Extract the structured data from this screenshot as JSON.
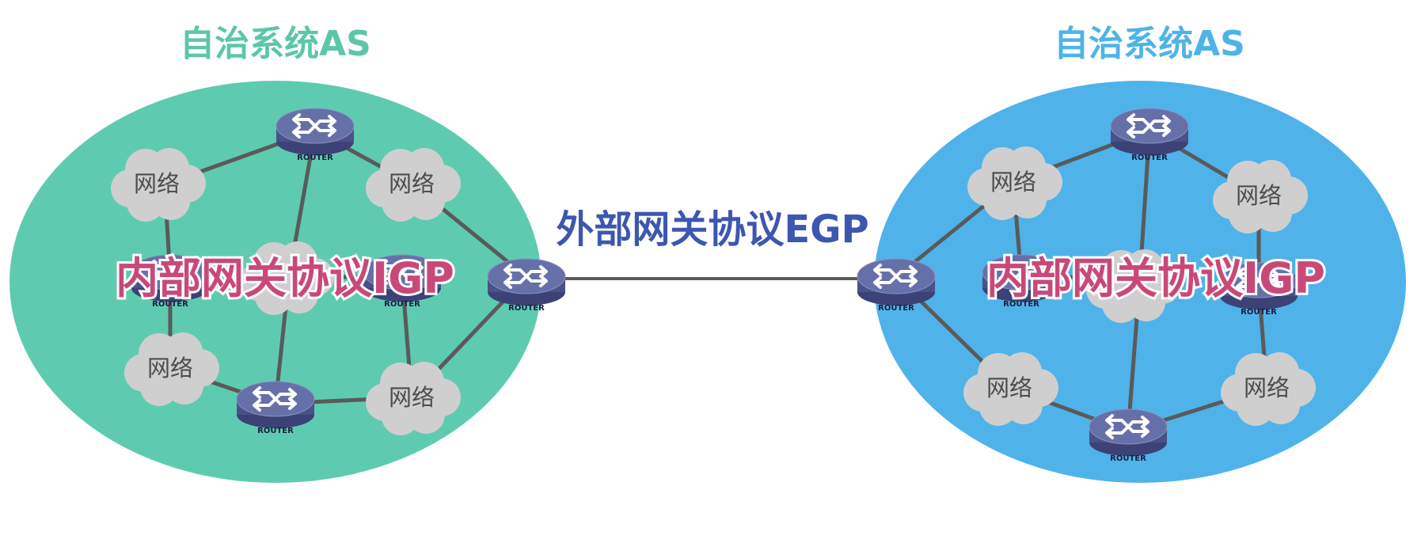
{
  "left_as": {
    "title": "自治系统AS",
    "title_color": "#5cc6a9",
    "fill_color": "#5ecbb0",
    "protocol_label": "内部网关协议IGP"
  },
  "right_as": {
    "title": "自治系统AS",
    "title_color": "#4fb3e7",
    "fill_color": "#4fb3ea",
    "protocol_label": "内部网关协议IGP"
  },
  "link": {
    "label": "外部网关协议EGP"
  },
  "cloud_label": "网络",
  "router_label": "ROUTER",
  "colors": {
    "router_top": "#6670a8",
    "router_side": "#4a5187",
    "cloud": "#cfcfcf",
    "link": "#5a5a5a",
    "igp_text": "#c9487a",
    "egp_text": "#3d57b0"
  },
  "icons": {
    "router": "router-icon",
    "network": "cloud-icon"
  }
}
